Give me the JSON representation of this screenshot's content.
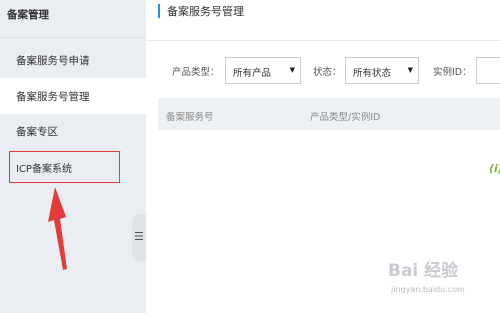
{
  "sidebar": {
    "header": "备案管理",
    "items": [
      {
        "label": "备案服务号申请"
      },
      {
        "label": "备案服务号管理"
      },
      {
        "label": "备案专区"
      },
      {
        "label": "ICP备案系统"
      }
    ]
  },
  "main": {
    "title": "备案服务号管理",
    "filters": {
      "product_type_label": "产品类型：",
      "product_type_value": "所有产品",
      "status_label": "状态：",
      "status_value": "所有状态",
      "instance_id_label": "实例ID：",
      "instance_id_value": ""
    },
    "table": {
      "columns": [
        "备案服务号",
        "产品类型/实例ID"
      ]
    }
  },
  "icons": {
    "collapse": "collapse-handle-icon",
    "info": "info-icon",
    "dropdown": "chevron-down-icon"
  },
  "annotation": {
    "color": "#e23b3b"
  },
  "watermark": {
    "brand": "Bai 经验",
    "url": "jingyan.baidu.com"
  }
}
